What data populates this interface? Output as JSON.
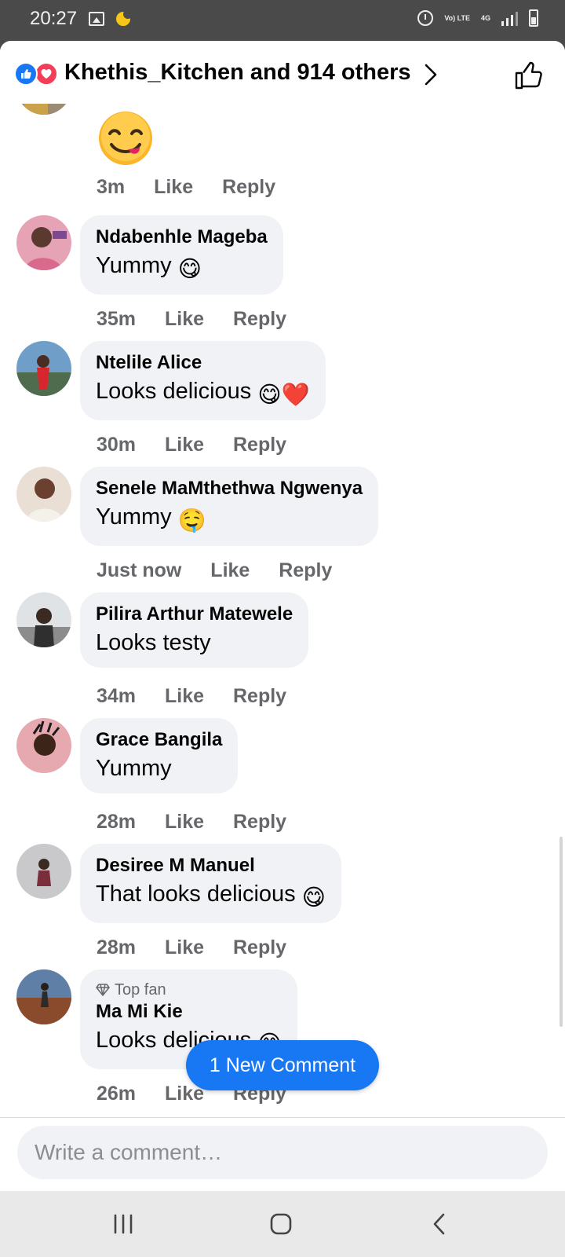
{
  "status_bar": {
    "time": "20:27",
    "icons": [
      "gallery-icon",
      "moon-icon",
      "alarm-icon",
      "volte-icon",
      "4g-icon",
      "signal-icon",
      "battery-icon"
    ],
    "volte_label": "Vo) LTE",
    "network_label": "4G"
  },
  "header": {
    "likers_text": "Khethis_Kitchen and 914 others",
    "reaction_icons": [
      "like-reaction-icon",
      "love-reaction-icon"
    ]
  },
  "first_comment": {
    "emoji": "😋",
    "time": "3m",
    "like_label": "Like",
    "reply_label": "Reply"
  },
  "comments": [
    {
      "author": "Ndabenhle Mageba",
      "text": "Yummy",
      "emojis": "😋",
      "time": "35m",
      "like_label": "Like",
      "reply_label": "Reply",
      "top_fan": ""
    },
    {
      "author": "Ntelile Alice",
      "text": "Looks delicious",
      "emojis": "😋❤️",
      "time": "30m",
      "like_label": "Like",
      "reply_label": "Reply",
      "top_fan": ""
    },
    {
      "author": "Senele MaMthethwa Ngwenya",
      "text": "Yummy",
      "emojis": "🤤",
      "time": "Just now",
      "like_label": "Like",
      "reply_label": "Reply",
      "top_fan": ""
    },
    {
      "author": "Pilira Arthur Matewele",
      "text": "Looks testy",
      "emojis": "",
      "time": "34m",
      "like_label": "Like",
      "reply_label": "Reply",
      "top_fan": ""
    },
    {
      "author": "Grace Bangila",
      "text": "Yummy",
      "emojis": "",
      "time": "28m",
      "like_label": "Like",
      "reply_label": "Reply",
      "top_fan": ""
    },
    {
      "author": "Desiree M Manuel",
      "text": "That looks delicious",
      "emojis": "😋",
      "time": "28m",
      "like_label": "Like",
      "reply_label": "Reply",
      "top_fan": ""
    },
    {
      "author": "Ma Mi Kie",
      "text": "Looks delicious",
      "emojis": "😋",
      "time": "26m",
      "like_label": "Like",
      "reply_label": "Reply",
      "top_fan": "Top fan"
    }
  ],
  "new_comment_pill": "1 New Comment",
  "composer": {
    "placeholder": "Write a comment…"
  },
  "colors": {
    "accent": "#1877f2",
    "love": "#f33e58",
    "bubble": "#f0f2f5",
    "meta": "#65676b",
    "text": "#050505"
  }
}
